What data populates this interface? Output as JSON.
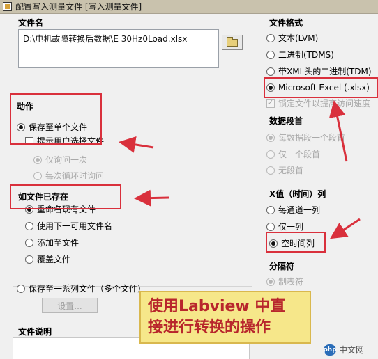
{
  "window": {
    "title": "配置写入测量文件 [写入测量文件]"
  },
  "file_name": {
    "label": "文件名",
    "value": "D:\\电机故障转换后数据\\E            30Hz0Load.xlsx",
    "browse_icon": "folder-icon"
  },
  "action": {
    "label": "动作",
    "save_single": "保存至单个文件",
    "prompt_user": "提示用户选择文件",
    "ask_once": "仅询问一次",
    "ask_every_loop": "每次循环时询问"
  },
  "if_exists": {
    "label": "如文件已存在",
    "options": [
      "重命名现有文件",
      "使用下一可用文件名",
      "添加至文件",
      "覆盖文件"
    ]
  },
  "save_series": {
    "label": "保存至一系列文件（多个文件）",
    "settings_button": "设置..."
  },
  "file_description": {
    "label": "文件说明"
  },
  "file_format": {
    "label": "文件格式",
    "options": [
      "文本(LVM)",
      "二进制(TDMS)",
      "带XML头的二进制(TDM)",
      "Microsoft Excel (.xlsx)"
    ],
    "lock_file": "锁定文件以提高访问速度"
  },
  "data_segment": {
    "label": "数据段首",
    "options": [
      "每数据段一个段首",
      "仅一个段首",
      "无段首"
    ]
  },
  "x_value": {
    "label": "X值（时间）列",
    "options": [
      "每通道一列",
      "仅一列",
      "空时间列"
    ]
  },
  "delimiter": {
    "label": "分隔符",
    "tab": "制表符"
  },
  "annotation": {
    "line1": "使用Labview 中直",
    "line2": "接进行转换的操作"
  },
  "watermark": {
    "logo": "php",
    "text": "中文网"
  },
  "colors": {
    "highlight_red": "#d9303c",
    "titlebar": "#c9c2ad",
    "callout_bg": "#f6e78a"
  }
}
